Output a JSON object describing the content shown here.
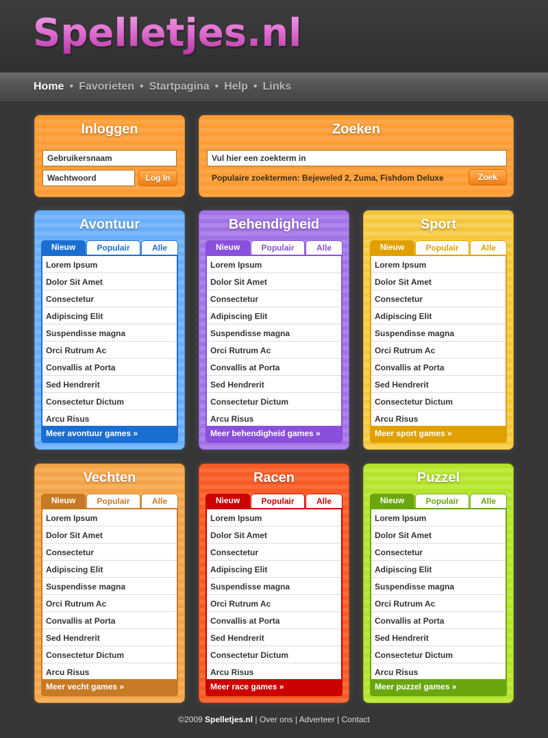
{
  "logo": "Spelletjes.nl",
  "nav": [
    "Home",
    "Favorieten",
    "Startpagina",
    "Help",
    "Links"
  ],
  "login": {
    "title": "Inloggen",
    "username_placeholder": "Gebruikersnaam",
    "password_placeholder": "Wachtwoord",
    "button": "Log In"
  },
  "search": {
    "title": "Zoeken",
    "placeholder": "Vul hier een zoekterm in",
    "popular": "Populaire zoektermen: Bejeweled 2, Zuma, Fishdom Deluxe",
    "button": "Zoek"
  },
  "tabs": [
    "Nieuw",
    "Populair",
    "Alle"
  ],
  "games": [
    "Lorem Ipsum",
    "Dolor Sit Amet",
    "Consectetur",
    "Adipiscing Elit",
    "Suspendisse magna",
    "Orci Rutrum Ac",
    "Convallis at Porta",
    "Sed Hendrerit",
    "Consectetur Dictum",
    "Arcu Risus"
  ],
  "categories": [
    {
      "title": "Avontuur",
      "more": "Meer avontuur games »",
      "color": "#1a6ed1"
    },
    {
      "title": "Behendigheid",
      "more": "Meer behendigheid games »",
      "color": "#8a4fdb"
    },
    {
      "title": "Sport",
      "more": "Meer sport games »",
      "color": "#e0a000"
    },
    {
      "title": "Vechten",
      "more": "Meer vecht games »",
      "color": "#c77a26"
    },
    {
      "title": "Racen",
      "more": "Meer race games »",
      "color": "#cc0000"
    },
    {
      "title": "Puzzel",
      "more": "Meer puzzel games »",
      "color": "#6aa610"
    }
  ],
  "footer": {
    "copyright": "©2009 ",
    "site": "Spelletjes.nl",
    "links": [
      "Over ons",
      "Adverteer",
      "Contact"
    ]
  }
}
